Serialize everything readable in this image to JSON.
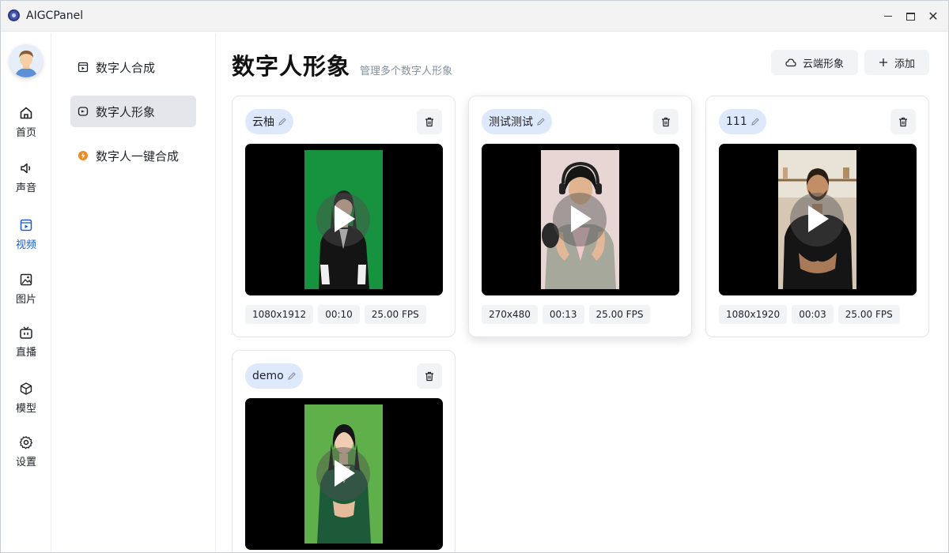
{
  "app": {
    "title": "AIGCPanel"
  },
  "rail": {
    "items": [
      {
        "label": "首页",
        "icon": "home-icon"
      },
      {
        "label": "声音",
        "icon": "speaker-icon"
      },
      {
        "label": "视频",
        "icon": "video-icon",
        "active": true
      },
      {
        "label": "图片",
        "icon": "image-icon"
      },
      {
        "label": "直播",
        "icon": "tv-icon"
      },
      {
        "label": "模型",
        "icon": "cube-icon"
      },
      {
        "label": "设置",
        "icon": "gear-icon"
      }
    ]
  },
  "subnav": {
    "items": [
      {
        "label": "数字人合成",
        "icon": "video-frame-icon"
      },
      {
        "label": "数字人形象",
        "icon": "avatar-frame-icon",
        "active": true
      },
      {
        "label": "数字人一键合成",
        "icon": "lightning-badge-icon"
      }
    ]
  },
  "header": {
    "title": "数字人形象",
    "subtitle": "管理多个数字人形象",
    "cloud_button": "云端形象",
    "add_button": "添加"
  },
  "cards": [
    {
      "name": "云柚",
      "resolution": "1080x1912",
      "duration": "00:10",
      "fps": "25.00 FPS"
    },
    {
      "name": "测试测试",
      "resolution": "270x480",
      "duration": "00:13",
      "fps": "25.00 FPS"
    },
    {
      "name": "111",
      "resolution": "1080x1920",
      "duration": "00:03",
      "fps": "25.00 FPS"
    },
    {
      "name": "demo"
    }
  ],
  "colors": {
    "accent": "#1f5bd8",
    "chip_bg": "#f2f3f5",
    "name_tag_bg": "#dde8fb"
  }
}
